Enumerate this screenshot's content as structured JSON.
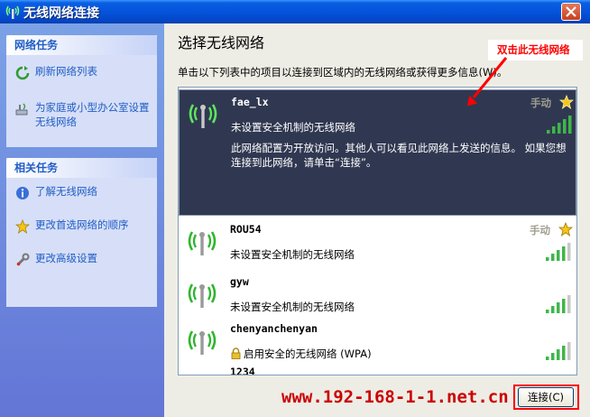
{
  "window": {
    "title": "无线网络连接"
  },
  "sidebar": {
    "network_tasks": {
      "header": "网络任务",
      "items": [
        {
          "label": "刷新网络列表",
          "icon": "refresh-icon"
        },
        {
          "label": "为家庭或小型办公室设置无线网络",
          "icon": "setup-wireless-icon"
        }
      ]
    },
    "related_tasks": {
      "header": "相关任务",
      "items": [
        {
          "label": "了解无线网络",
          "icon": "info-icon"
        },
        {
          "label": "更改首选网络的顺序",
          "icon": "star-icon"
        },
        {
          "label": "更改高级设置",
          "icon": "wrench-icon"
        }
      ]
    }
  },
  "main": {
    "title": "选择无线网络",
    "description": "单击以下列表中的项目以连接到区域内的无线网络或获得更多信息(W)。",
    "annotation": "双击此无线网络",
    "networks": [
      {
        "ssid": "fae_lx",
        "mode": "手动",
        "security": "未设置安全机制的无线网络",
        "detail": "此网络配置为开放访问。其他人可以看见此网络上发送的信息。 如果您想连接到此网络，请单击“连接”。",
        "signal_bars": 5,
        "selected": true
      },
      {
        "ssid": "ROU54",
        "mode": "手动",
        "security": "未设置安全机制的无线网络",
        "signal_bars": 4
      },
      {
        "ssid": "gyw",
        "security": "未设置安全机制的无线网络",
        "signal_bars": 4
      },
      {
        "ssid": "chenyanchenyan",
        "security": "启用安全的无线网络 (WPA)",
        "signal_bars": 4
      }
    ],
    "partial_next_ssid": "1234",
    "connect_button": "连接(C)",
    "watermark": "www.192-168-1-1.net.cn"
  },
  "colors": {
    "titlebar": "#0553dc",
    "sidebar": "#6f8ddf",
    "selected_row": "#303851",
    "signal_green": "#3fb64a",
    "annotation_red": "#ff0000"
  }
}
